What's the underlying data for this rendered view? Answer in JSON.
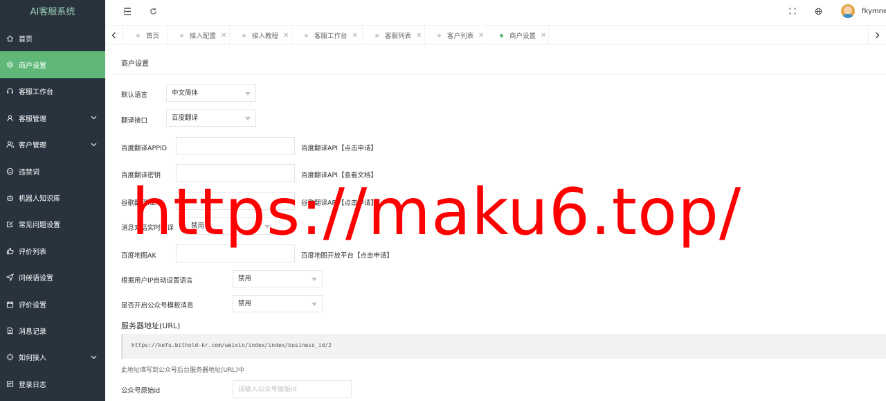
{
  "app": {
    "title": "AI客服系统"
  },
  "sidebar": {
    "items": [
      {
        "label": "首页",
        "icon": "home-icon",
        "active": false,
        "arrow": false
      },
      {
        "label": "商户设置",
        "icon": "gear-icon",
        "active": true,
        "arrow": false
      },
      {
        "label": "客服工作台",
        "icon": "headset-icon",
        "active": false,
        "arrow": false
      },
      {
        "label": "客服管理",
        "icon": "user-icon",
        "active": false,
        "arrow": true
      },
      {
        "label": "客户管理",
        "icon": "users-icon",
        "active": false,
        "arrow": true
      },
      {
        "label": "违禁词",
        "icon": "smile-icon",
        "active": false,
        "arrow": false
      },
      {
        "label": "机器人知识库",
        "icon": "robot-icon",
        "active": false,
        "arrow": false
      },
      {
        "label": "常见问题设置",
        "icon": "edit-icon",
        "active": false,
        "arrow": false
      },
      {
        "label": "评价列表",
        "icon": "thumb-up-icon",
        "active": false,
        "arrow": false
      },
      {
        "label": "问候语设置",
        "icon": "send-icon",
        "active": false,
        "arrow": false
      },
      {
        "label": "评价设置",
        "icon": "calendar-icon",
        "active": false,
        "arrow": false
      },
      {
        "label": "消息记录",
        "icon": "file-icon",
        "active": false,
        "arrow": false
      },
      {
        "label": "如何接入",
        "icon": "settings-icon",
        "active": false,
        "arrow": true
      },
      {
        "label": "登录日志",
        "icon": "log-icon",
        "active": false,
        "arrow": false
      }
    ]
  },
  "header": {
    "username": "fkymnet"
  },
  "tabs": [
    {
      "label": "首页",
      "active": false,
      "closable": false
    },
    {
      "label": "接入配置",
      "active": false,
      "closable": true
    },
    {
      "label": "接入教程",
      "active": false,
      "closable": true
    },
    {
      "label": "客服工作台",
      "active": false,
      "closable": true
    },
    {
      "label": "客服列表",
      "active": false,
      "closable": true
    },
    {
      "label": "客户列表",
      "active": false,
      "closable": true
    },
    {
      "label": "商户设置",
      "active": true,
      "closable": true
    }
  ],
  "form": {
    "card_title": "商户设置",
    "default_language": {
      "label": "默认语言",
      "value": "中文简体"
    },
    "translate_api": {
      "label": "翻译接口",
      "value": "百度翻译"
    },
    "baidu_appid": {
      "label": "百度翻译APPID",
      "value": "",
      "hint": "百度翻译API【点击申请】"
    },
    "baidu_secret": {
      "label": "百度翻译密钥",
      "value": "",
      "hint": "百度翻译API【查看文档】"
    },
    "google_key": {
      "label": "谷歌翻译KEY",
      "value": "",
      "hint": "谷歌翻译API【点击申请】"
    },
    "realtime_translate": {
      "label": "消息对话实时翻译",
      "value": "禁用"
    },
    "baidu_map_ak": {
      "label": "百度地图AK",
      "value": "",
      "hint": "百度地图开放平台【点击申请】"
    },
    "auto_lang_by_ip": {
      "label": "根据用户IP自动设置语言",
      "value": "禁用"
    },
    "wechat_template": {
      "label": "是否开启公众号模板消息",
      "value": "禁用"
    },
    "server_url": {
      "title": "服务器地址(URL)",
      "value": "https://kefu.bithold-kr.com/weixin/index/index/business_id/2",
      "note": "此地址填写到公众号后台服务器地址(URL)中"
    },
    "wechat_original_id": {
      "label": "公众号原始id",
      "placeholder": "请输入公众号原始id"
    }
  },
  "watermark": "https://maku6.top/"
}
